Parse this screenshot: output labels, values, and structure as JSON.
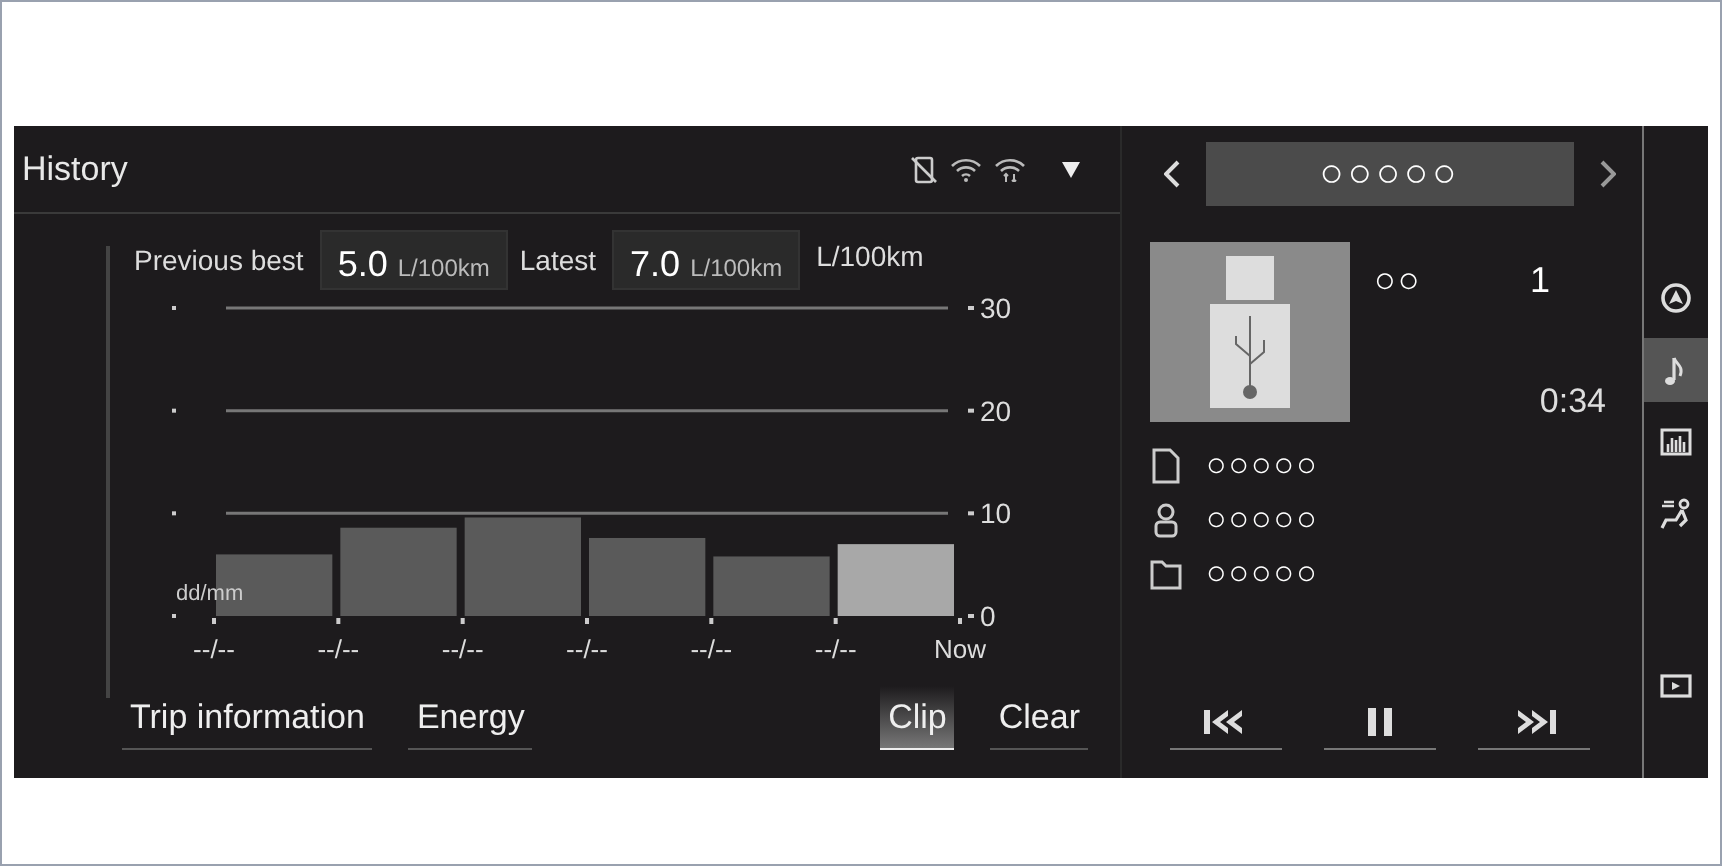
{
  "history": {
    "title": "History",
    "stats": [
      {
        "label": "Previous best",
        "value": "5.0",
        "unit": "L/100km"
      },
      {
        "label": "Latest",
        "value": "7.0",
        "unit": "L/100km"
      }
    ],
    "chart_data": {
      "type": "bar",
      "xlabel": "dd/mm",
      "ylabel": "L/100km",
      "categories": [
        "--/--",
        "--/--",
        "--/--",
        "--/--",
        "--/--",
        "--/--",
        "Now"
      ],
      "ylim": [
        0,
        30
      ],
      "yticks": [
        0,
        10,
        20,
        30
      ],
      "series": [
        {
          "color": "#5a5a5a",
          "values": [
            6.0,
            8.6,
            9.6,
            7.6,
            5.8,
            null,
            null
          ]
        },
        {
          "color": "#a8a8a8",
          "values": [
            null,
            null,
            null,
            null,
            null,
            7.0,
            null
          ]
        }
      ]
    },
    "buttons": [
      {
        "label": "Trip information",
        "pressed": false
      },
      {
        "label": "Energy",
        "pressed": false
      },
      {
        "label": "Clip",
        "pressed": true
      },
      {
        "label": "Clear",
        "pressed": false
      }
    ]
  },
  "media": {
    "source": "○○○○○",
    "album_label": "○○",
    "track_number": "1",
    "elapsed": "0:34",
    "info": [
      {
        "kind": "title",
        "text": "○○○○○"
      },
      {
        "kind": "artist",
        "text": "○○○○○"
      },
      {
        "kind": "folder",
        "text": "○○○○○"
      }
    ]
  },
  "side_menu": [
    {
      "kind": "navigation",
      "selected": false
    },
    {
      "kind": "music",
      "selected": true
    },
    {
      "kind": "info",
      "selected": false
    },
    {
      "kind": "climate",
      "selected": false
    },
    {
      "kind": "display",
      "selected": false
    }
  ]
}
